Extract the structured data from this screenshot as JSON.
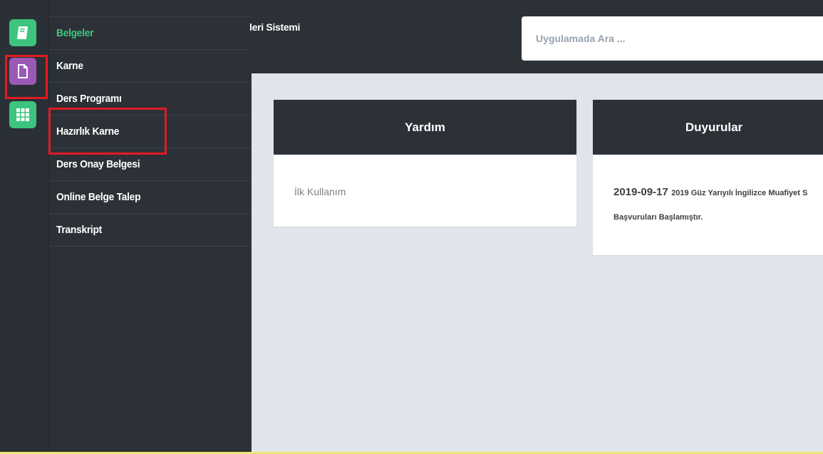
{
  "header": {
    "title": "leri Sistemi",
    "search_placeholder": "Uygulamada Ara ..."
  },
  "rail": {
    "items": [
      {
        "icon": "book-icon",
        "color": "#3dc47e"
      },
      {
        "icon": "document-icon",
        "color": "#9b59b6",
        "selected": true
      },
      {
        "icon": "grid-apps-icon",
        "color": "#3dc47e"
      }
    ]
  },
  "sidebar": {
    "items": [
      {
        "label": "Belgeler",
        "active": true
      },
      {
        "label": "Karne"
      },
      {
        "label": "Ders Programı"
      },
      {
        "label": "Hazırlık Karne",
        "highlighted": true
      },
      {
        "label": "Ders Onay Belgesi"
      },
      {
        "label": "Online Belge Talep"
      },
      {
        "label": "Transkript"
      }
    ]
  },
  "panels": {
    "yardim": {
      "title": "Yardım",
      "link": "İlk Kullanım"
    },
    "duyurular": {
      "title": "Duyurular",
      "date": "2019-09-17",
      "text_line1": "2019 Güz Yarıyılı İngilizce Muafiyet S",
      "text_line2": "Başvuruları Başlamıştır."
    }
  },
  "colors": {
    "dark": "#2c3137",
    "accent_green": "#3dc47e",
    "accent_purple": "#9b59b6",
    "highlight_red": "#e21b23",
    "content_bg": "#e1e4ea"
  }
}
